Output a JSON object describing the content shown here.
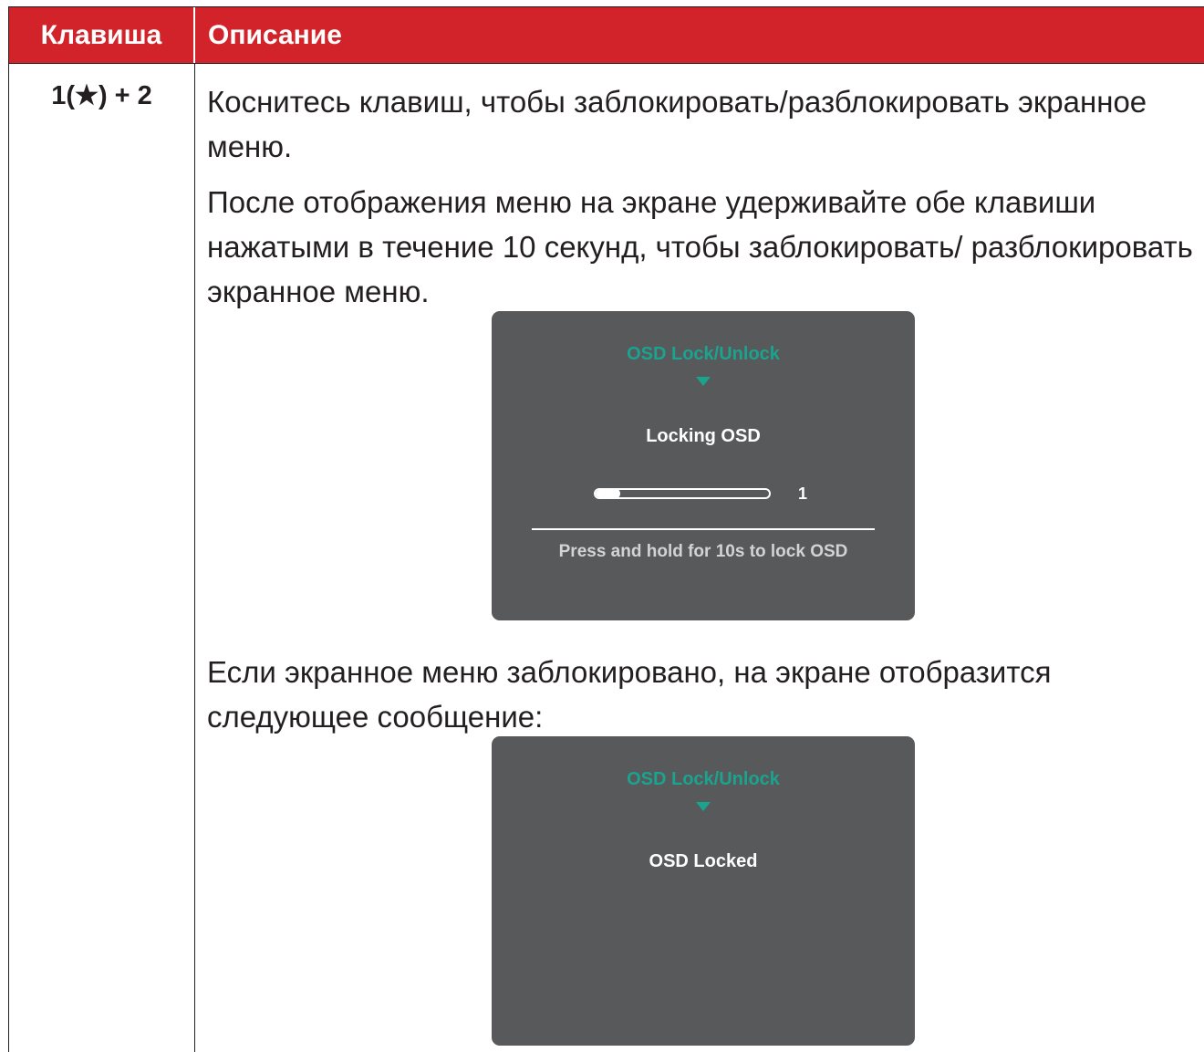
{
  "table": {
    "header_key": "Клавиша",
    "header_desc": "Описание",
    "key_combo": "1(★) + 2",
    "paragraph_1": "Коснитесь клавиш, чтобы заблокировать/разблокировать экранное меню.",
    "paragraph_2": "После отображения меню на экране удерживайте обе клавиши нажатыми в течение 10 секунд, чтобы заблокировать/ разблокировать экранное меню.",
    "paragraph_3": "Если экранное меню заблокировано, на экране отобразится следующее сообщение:"
  },
  "osd_locking": {
    "title": "OSD Lock/Unlock",
    "message": "Locking OSD",
    "progress_value": "1",
    "progress_fraction": 0.11,
    "hint": "Press and hold for 10s to lock OSD"
  },
  "osd_locked": {
    "title": "OSD Lock/Unlock",
    "message": "OSD Locked"
  },
  "colors": {
    "header_bg": "#d2232a",
    "osd_bg": "#58595b",
    "osd_accent": "#1aa38f"
  }
}
